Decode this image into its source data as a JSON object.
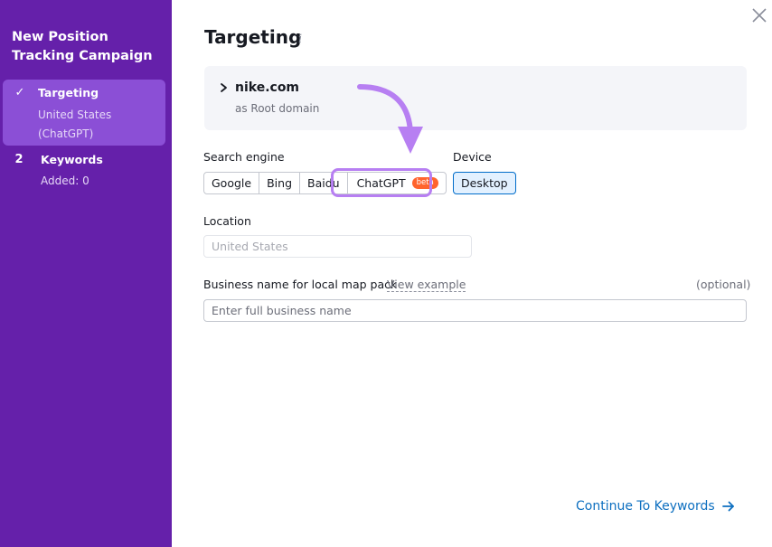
{
  "sidebar": {
    "title": "New Position Tracking Campaign",
    "steps": [
      {
        "marker": "✓",
        "label": "Targeting",
        "sub": "United States (ChatGPT)",
        "active": true
      },
      {
        "marker": "2",
        "label": "Keywords",
        "sub": "Added: 0",
        "active": false
      }
    ]
  },
  "main": {
    "title": "Targeting",
    "info_icon": "i",
    "domain": {
      "name": "nike.com",
      "type": "as Root domain"
    },
    "search_engine": {
      "label": "Search engine",
      "options": [
        "Google",
        "Bing",
        "Baidu",
        "ChatGPT"
      ],
      "selected": "ChatGPT",
      "badge": "beta"
    },
    "device": {
      "label": "Device",
      "selected": "Desktop"
    },
    "location": {
      "label": "Location",
      "placeholder": "United States"
    },
    "business": {
      "label": "Business name for local map pack",
      "link": "View example",
      "optional": "(optional)",
      "placeholder": "Enter full business name"
    },
    "continue_label": "Continue To Keywords"
  },
  "colors": {
    "sidebar_bg": "#6520aa",
    "active_step_bg": "#8b4fd6",
    "highlight": "#b77ff2",
    "badge": "#ff642d",
    "link": "#0d6fc0"
  },
  "icons": [
    "check-icon",
    "info-icon",
    "chevron-right-icon",
    "close-icon",
    "arrow-right-icon",
    "annotation-arrow"
  ]
}
